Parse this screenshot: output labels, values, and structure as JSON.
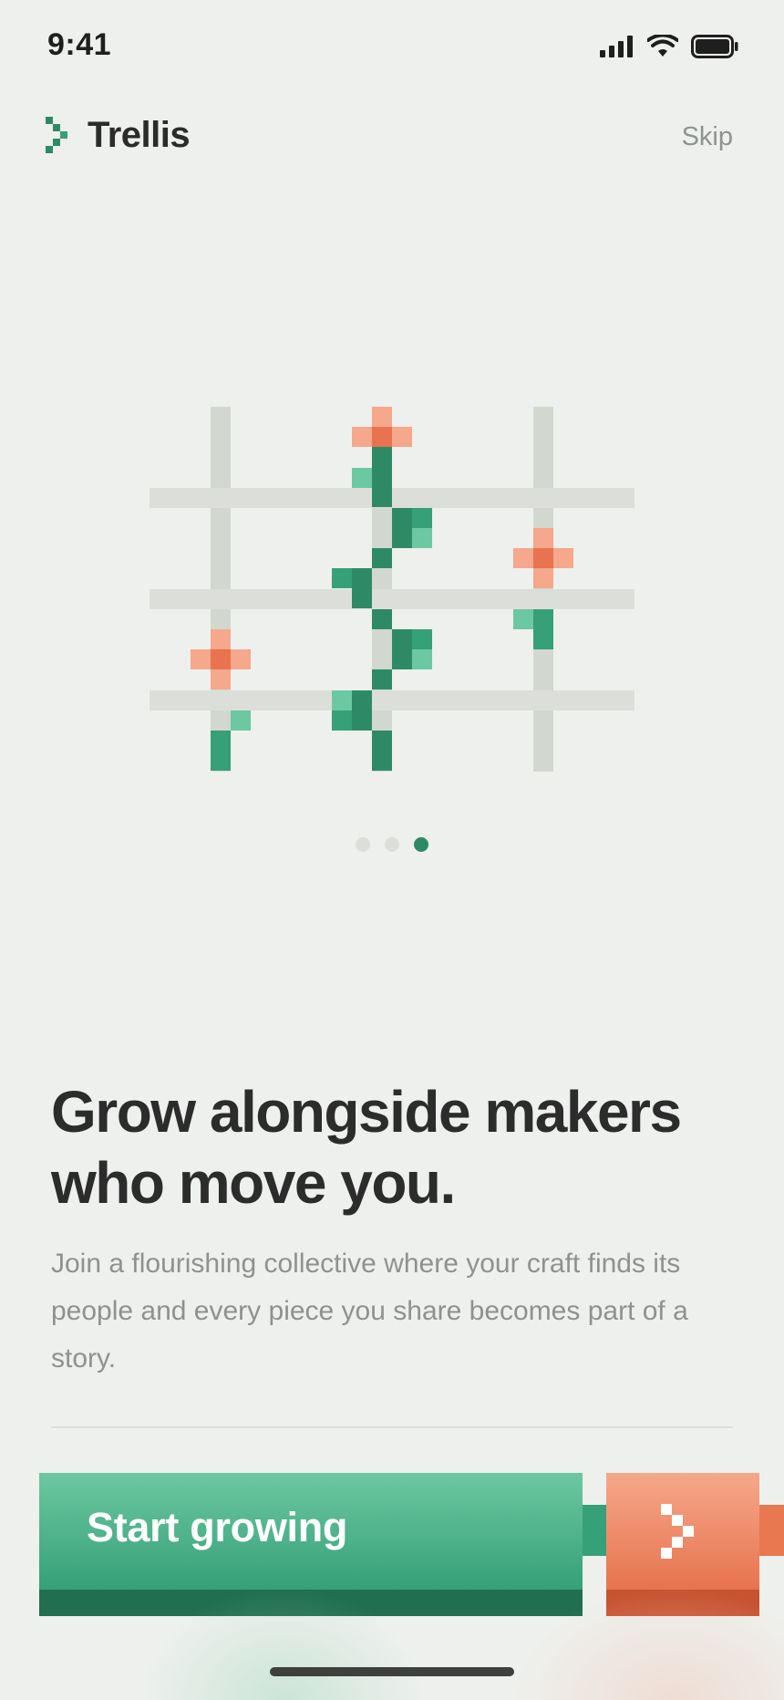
{
  "status_bar": {
    "time": "9:41"
  },
  "header": {
    "app_name": "Trellis",
    "skip_label": "Skip"
  },
  "pager": {
    "total": 3,
    "active_index": 3
  },
  "content": {
    "headline": "Grow alongside makers who move you.",
    "subheadline": "Join a flourishing collective where your craft finds its people and every piece you share becomes part of a story."
  },
  "cta": {
    "primary_label": "Start growing",
    "next_icon": "chevron-right-icon"
  },
  "colors": {
    "background": "#eef0ed",
    "brand_green": "#2e8a66",
    "accent_coral": "#e8734e",
    "trellis_gray": "#d5d9d2"
  }
}
